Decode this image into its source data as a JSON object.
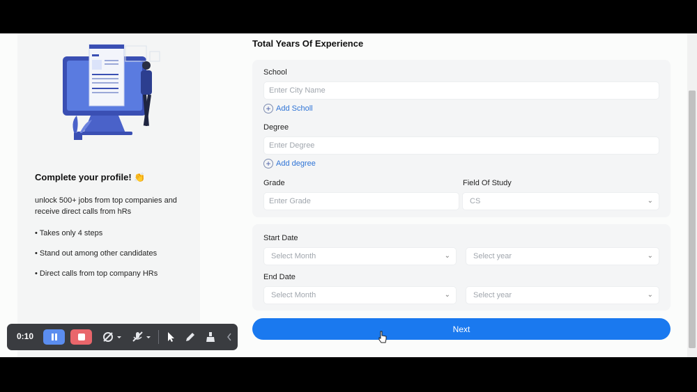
{
  "left": {
    "title": "Complete your profile! 👏",
    "subtitle": "unlock 500+ jobs from top companies and receive direct calls from hRs",
    "bullets": [
      "• Takes only 4 steps",
      "• Stand out among other candidates",
      "• Direct calls from top company HRs"
    ]
  },
  "main": {
    "section_title": "Total Years Of Experience",
    "school_label": "School",
    "school_placeholder": "Enter City Name",
    "add_school": "Add Scholl",
    "degree_label": "Degree",
    "degree_placeholder": "Enter Degree",
    "add_degree": "Add degree",
    "grade_label": "Grade",
    "grade_placeholder": "Enter Grade",
    "field_label": "Field Of Study",
    "field_value": "CS",
    "start_label": "Start Date",
    "end_label": "End Date",
    "month_placeholder": "Select Month",
    "year_placeholder": "Select year",
    "next_label": "Next"
  },
  "recorder": {
    "time": "0:10"
  },
  "colors": {
    "accent": "#1a79ef",
    "link": "#2f74d6",
    "stop": "#e9666b",
    "pause": "#5b8def"
  }
}
